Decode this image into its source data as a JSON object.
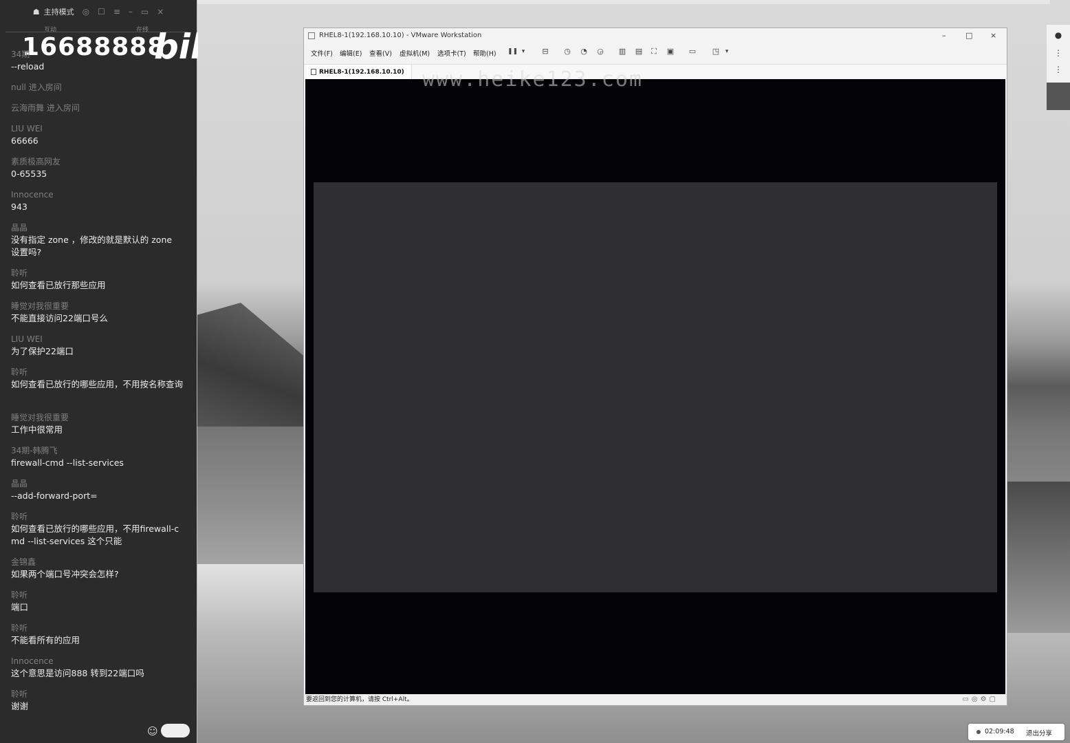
{
  "chat": {
    "header_mode": "主持模式",
    "tab_left": "互动",
    "tab_right": "在线",
    "room_number": "16688888",
    "logo_text": "bili",
    "messages": [
      {
        "nick": "34期",
        "text": "--reload"
      },
      {
        "nick": "null 进入房间",
        "text": ""
      },
      {
        "nick": "云海雨舞 进入房间",
        "text": ""
      },
      {
        "nick": "LIU WEI",
        "text": "66666"
      },
      {
        "nick": "素质极高网友",
        "text": "0-65535"
      },
      {
        "nick": "Innocence",
        "text": "943"
      },
      {
        "nick": "晶晶",
        "text": "没有指定 zone ，修改的就是默认的 zone 设置吗?"
      },
      {
        "nick": "聆听",
        "text": "如何查看已放行那些应用"
      },
      {
        "nick": "睡觉对我很重要",
        "text": "不能直接访问22端口号么"
      },
      {
        "nick": "LIU WEI",
        "text": "为了保护22端口"
      },
      {
        "nick": "聆听",
        "text": "如何查看已放行的哪些应用，不用按名称查询"
      },
      {
        "nick": "睡觉对我很重要",
        "text": "工作中很常用"
      },
      {
        "nick": "34期-韩腾飞",
        "text": "firewall-cmd --list-services"
      },
      {
        "nick": "晶晶",
        "text": "--add-forward-port="
      },
      {
        "nick": "聆听",
        "text": "如何查看已放行的哪些应用，不用firewall-cmd --list-services  这个只能"
      },
      {
        "nick": "金锦鑫",
        "text": "如果两个端口号冲突会怎样?"
      },
      {
        "nick": "聆听",
        "text": "端口"
      },
      {
        "nick": "聆听",
        "text": "不能看所有的应用"
      },
      {
        "nick": "Innocence",
        "text": "这个意思是访问888 转到22端口吗"
      },
      {
        "nick": "聆听",
        "text": "谢谢"
      }
    ]
  },
  "vmware": {
    "window_title": "RHEL8-1(192.168.10.10) - VMware Workstation",
    "menu": [
      "文件(F)",
      "编辑(E)",
      "查看(V)",
      "虚拟机(M)",
      "选项卡(T)",
      "帮助(H)"
    ],
    "tab_label": "RHEL8-1(192.168.10.10)",
    "status_message": "要返回到您的计算机，请按 Ctrl+Alt。",
    "minimize": "–",
    "maximize": "□",
    "close": "×"
  },
  "watermark": "www.heike123.com",
  "share": {
    "timer": "02:09:48",
    "stop_label": "退出分享"
  },
  "icons": {
    "pause": "❚❚",
    "dropdown": "▾",
    "emoji": "☺"
  }
}
